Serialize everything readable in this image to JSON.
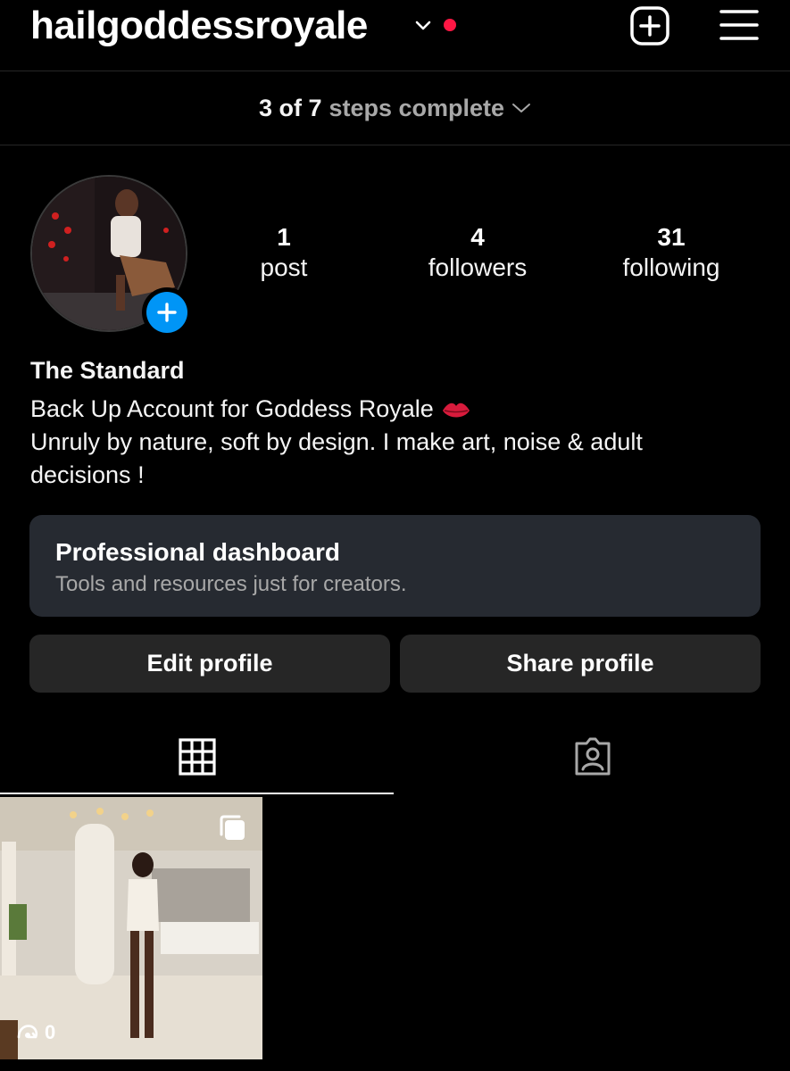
{
  "header": {
    "username": "hailgoddessroyale",
    "icons": {
      "account_switch": "chevron-down-icon",
      "notification": "red-dot",
      "create": "plus-square-icon",
      "menu": "hamburger-icon"
    },
    "notification_color": "#ff1744"
  },
  "steps": {
    "count": "3 of 7",
    "label": "steps complete"
  },
  "profile": {
    "display_name": "The Standard",
    "bio_line1": "Back Up Account for Goddess Royale",
    "bio_emoji": "lips-emoji",
    "bio_line2": "Unruly by nature, soft by design. I make art, noise & adult decisions !"
  },
  "stats": {
    "posts": {
      "value": "1",
      "label": "post"
    },
    "followers": {
      "value": "4",
      "label": "followers"
    },
    "following": {
      "value": "31",
      "label": "following"
    }
  },
  "dashboard": {
    "title": "Professional dashboard",
    "subtitle": "Tools and resources just for creators."
  },
  "buttons": {
    "edit": "Edit profile",
    "share": "Share profile"
  },
  "tabs": [
    {
      "icon": "grid-icon",
      "active": true
    },
    {
      "icon": "tagged-icon",
      "active": false
    }
  ],
  "posts": [
    {
      "views": "0",
      "multi": true
    }
  ],
  "colors": {
    "accent": "#0095f6",
    "card": "#262a31",
    "button": "#262626"
  }
}
